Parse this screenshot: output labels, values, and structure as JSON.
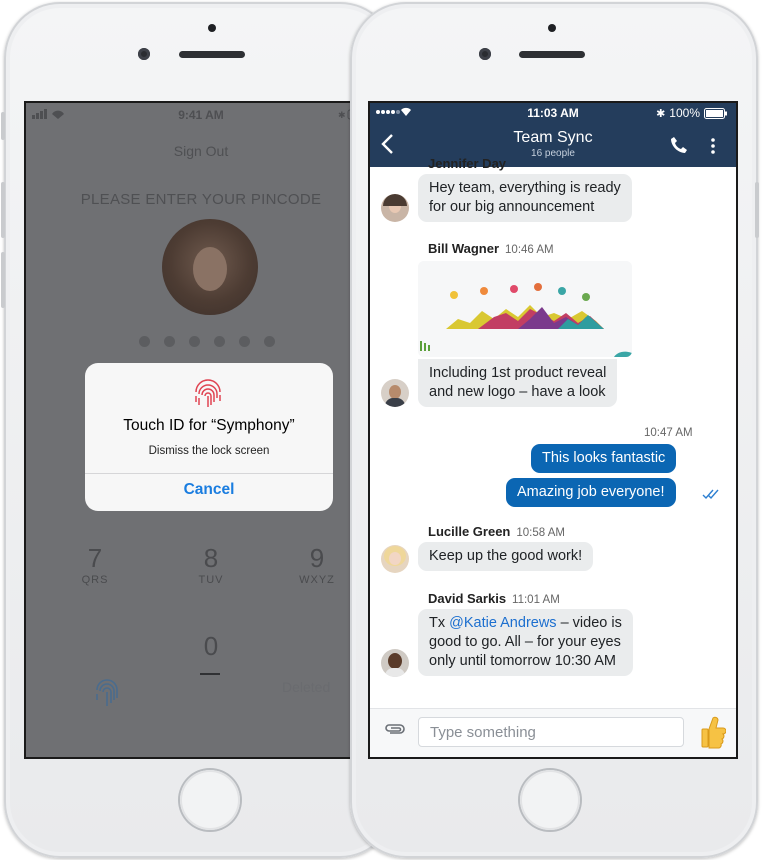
{
  "lock_screen": {
    "status_time": "9:41 AM",
    "sign_out": "Sign Out",
    "pin_prompt": "PLEASE ENTER YOUR PINCODE",
    "keys": [
      {
        "num": "7",
        "letters": "QRS"
      },
      {
        "num": "8",
        "letters": "TUV"
      },
      {
        "num": "9",
        "letters": "WXYZ"
      },
      {
        "num": "0",
        "letters": ""
      }
    ],
    "deleted_label": "Deleted"
  },
  "touch_id_dialog": {
    "title": "Touch ID for “Symphony”",
    "subtitle": "Dismiss the lock screen",
    "cancel_label": "Cancel"
  },
  "chat": {
    "status_time": "11:03 AM",
    "battery": "100%",
    "title": "Team Sync",
    "people_count": "16 people",
    "partial_name": "Jennifer Day",
    "messages": [
      {
        "lines": [
          "Hey team, everything is ready",
          "for our big announcement"
        ]
      },
      {
        "name": "Bill Wagner",
        "time": "10:46 AM",
        "lines": [
          "Including 1st product reveal",
          "and new logo – have a look"
        ]
      },
      {
        "time": "10:47 AM",
        "lines": [
          "This looks fantastic"
        ]
      },
      {
        "lines": [
          "Amazing job everyone!"
        ]
      },
      {
        "name": "Lucille Green",
        "time": "10:58 AM",
        "lines": [
          "Keep up the good work!"
        ]
      },
      {
        "name": "David Sarkis",
        "time": "11:01 AM",
        "prefix": "Tx ",
        "mention": "@Katie Andrews",
        "rest": " – video is",
        "lines": [
          "good to go. All – for your eyes",
          "only until tomorrow 10:30 AM"
        ]
      }
    ],
    "composer_placeholder": "Type something"
  },
  "colors": {
    "header": "#243d5c",
    "my_bubble": "#0b66b3",
    "mention": "#1c6fcf",
    "cancel": "#1a7de0"
  }
}
